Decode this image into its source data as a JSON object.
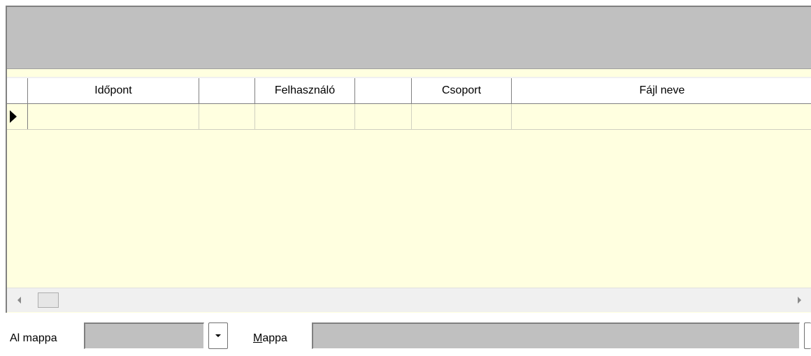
{
  "grid": {
    "columns": [
      "Időpont",
      "",
      "Felhasználó",
      "",
      "Csoport",
      "Fájl neve"
    ],
    "rows": [
      [
        "",
        "",
        "",
        "",
        "",
        ""
      ]
    ]
  },
  "filters": {
    "al_mappa_label": "Al mappa",
    "al_mappa_value": "",
    "mappa_label_accel": "M",
    "mappa_label_rest": "appa",
    "mappa_value": ""
  },
  "icons": {
    "row_indicator": "current-row-triangle-icon",
    "scroll_left": "scroll-left-arrow-icon",
    "scroll_right": "scroll-right-arrow-icon",
    "dropdown": "chevron-down-icon"
  },
  "colors": {
    "panel_gray": "#c0c0c0",
    "grid_background": "#ffffe0",
    "header_background": "#ffffff"
  }
}
